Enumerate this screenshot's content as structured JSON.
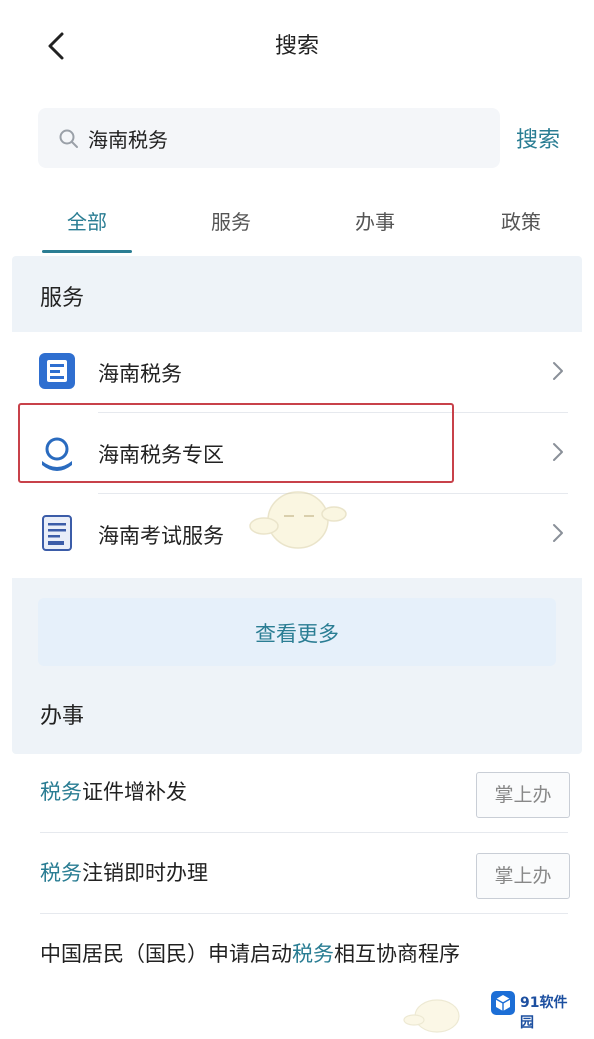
{
  "header": {
    "title": "搜索"
  },
  "search": {
    "query": "海南税务",
    "button_label": "搜索"
  },
  "tabs": [
    {
      "label": "全部",
      "active": true
    },
    {
      "label": "服务",
      "active": false
    },
    {
      "label": "办事",
      "active": false
    },
    {
      "label": "政策",
      "active": false
    }
  ],
  "services": {
    "heading": "服务",
    "items": [
      {
        "label": "海南税务",
        "icon": "hainan-tax-app-icon"
      },
      {
        "label": "海南税务专区",
        "icon": "tax-zone-icon"
      },
      {
        "label": "海南考试服务",
        "icon": "exam-service-icon"
      }
    ],
    "more_label": "查看更多"
  },
  "tasks": {
    "heading": "办事",
    "items": [
      {
        "keyword": "税务",
        "rest": "证件增补发",
        "action": "掌上办"
      },
      {
        "keyword": "税务",
        "rest": "注销即时办理",
        "action": "掌上办"
      },
      {
        "prefix": "中国居民（国民）申请启动",
        "keyword": "税务",
        "rest": "相互协商程序"
      }
    ]
  },
  "watermark": {
    "label": "91软件园"
  },
  "colors": {
    "accent": "#2a7d93",
    "highlight_border": "#c8414a",
    "section_bg": "#eef3f8"
  }
}
